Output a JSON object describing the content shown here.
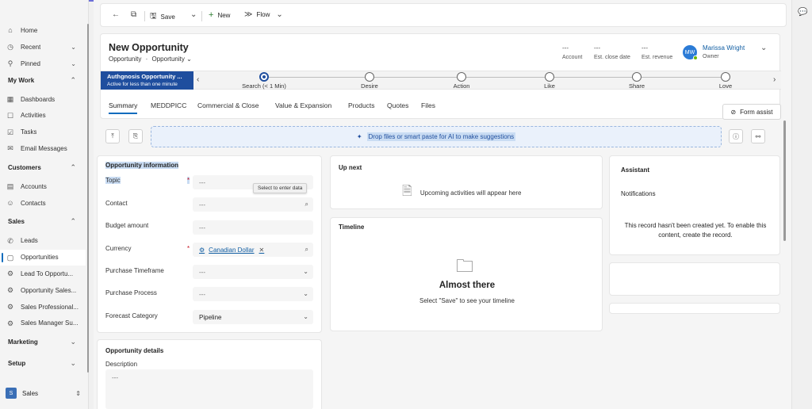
{
  "sidebar": {
    "items": [
      {
        "label": "Home",
        "icon": "home-icon",
        "glyph": "⌂",
        "chevron": ""
      },
      {
        "label": "Recent",
        "icon": "clock-icon",
        "glyph": "◷",
        "chevron": "⌄"
      },
      {
        "label": "Pinned",
        "icon": "pin-icon",
        "glyph": "⚲",
        "chevron": "⌄"
      }
    ],
    "groups": [
      {
        "label": "My Work",
        "chevron": "⌃",
        "items": [
          {
            "label": "Dashboards",
            "icon": "dashboard-icon",
            "glyph": "▦"
          },
          {
            "label": "Activities",
            "icon": "activities-icon",
            "glyph": "☐"
          },
          {
            "label": "Tasks",
            "icon": "tasks-icon",
            "glyph": "☑"
          },
          {
            "label": "Email Messages",
            "icon": "mail-icon",
            "glyph": "✉"
          }
        ]
      },
      {
        "label": "Customers",
        "chevron": "⌃",
        "items": [
          {
            "label": "Accounts",
            "icon": "building-icon",
            "glyph": "▤"
          },
          {
            "label": "Contacts",
            "icon": "person-icon",
            "glyph": "☺"
          }
        ]
      },
      {
        "label": "Sales",
        "chevron": "⌃",
        "items": [
          {
            "label": "Leads",
            "icon": "phone-icon",
            "glyph": "✆"
          },
          {
            "label": "Opportunities",
            "icon": "opportunity-icon",
            "glyph": "▢"
          },
          {
            "label": "Lead To Opportu...",
            "icon": "process-icon",
            "glyph": "⚙"
          },
          {
            "label": "Opportunity Sales...",
            "icon": "process-icon",
            "glyph": "⚙"
          },
          {
            "label": "Sales Professional...",
            "icon": "process-icon",
            "glyph": "⚙"
          },
          {
            "label": "Sales Manager Su...",
            "icon": "process-icon",
            "glyph": "⚙"
          }
        ]
      },
      {
        "label": "Marketing",
        "chevron": "⌄",
        "items": []
      },
      {
        "label": "Setup",
        "chevron": "⌄",
        "items": []
      }
    ],
    "area": {
      "badge": "S",
      "label": "Sales",
      "chevron": "⇕"
    }
  },
  "commandbar": {
    "back_icon": "←",
    "popout_icon": "⧉",
    "save_icon": "🖫",
    "save_label": "Save",
    "save_more": "⌄",
    "new_icon": "+",
    "new_label": "New",
    "flow_icon": "≫",
    "flow_label": "Flow",
    "flow_more": "⌄"
  },
  "header": {
    "title": "New Opportunity",
    "entity": "Opportunity",
    "separator": "·",
    "form": "Opportunity",
    "form_chevron": "⌄",
    "fields": [
      {
        "value": "---",
        "label": "Account"
      },
      {
        "value": "---",
        "label": "Est. close date"
      },
      {
        "value": "---",
        "label": "Est. revenue"
      }
    ],
    "owner": {
      "initials": "MW",
      "name": "Marissa Wright",
      "role": "Owner",
      "chevron": "⌄"
    }
  },
  "bpf": {
    "active_name": "Authgnosis Opportunity ...",
    "active_sub": "Active for less than one minute",
    "prev_icon": "‹",
    "next_icon": "›",
    "stages": [
      {
        "name": "Search  (< 1 Min)",
        "active": true
      },
      {
        "name": "Desire",
        "active": false
      },
      {
        "name": "Action",
        "active": false
      },
      {
        "name": "Like",
        "active": false
      },
      {
        "name": "Share",
        "active": false
      },
      {
        "name": "Love",
        "active": false
      }
    ]
  },
  "tabs": [
    "Summary",
    "MEDDPICC",
    "Commercial & Close",
    "Value & Expansion",
    "Products",
    "Quotes",
    "Files"
  ],
  "form_assist": {
    "label": "Form assist",
    "icon": "eye-off-icon"
  },
  "dropzone": {
    "text": "Drop files or smart paste for AI to make suggestions",
    "icon": "sparkle-icon"
  },
  "toolbar_icons": {
    "upload": "⤒",
    "paste": "⎘",
    "info": "ⓘ",
    "link": "⚯"
  },
  "info_section": {
    "title": "Opportunity information",
    "tooltip": "Select to enter data",
    "fields": [
      {
        "label": "Topic",
        "required": true,
        "value": "---",
        "type": "text"
      },
      {
        "label": "Contact",
        "required": false,
        "value": "---",
        "type": "lookup"
      },
      {
        "label": "Budget amount",
        "required": false,
        "value": "---",
        "type": "text"
      },
      {
        "label": "Currency",
        "required": true,
        "value": "Canadian Dollar",
        "type": "lookup-set"
      },
      {
        "label": "Purchase Timeframe",
        "required": false,
        "value": "---",
        "type": "select"
      },
      {
        "label": "Purchase Process",
        "required": false,
        "value": "---",
        "type": "select"
      },
      {
        "label": "Forecast Category",
        "required": false,
        "value": "Pipeline",
        "type": "select"
      }
    ],
    "required_mark": "*"
  },
  "details_section": {
    "title": "Opportunity details",
    "description_label": "Description",
    "description_value": "---"
  },
  "up_next": {
    "title": "Up next",
    "message": "Upcoming activities will appear here"
  },
  "timeline": {
    "title": "Timeline",
    "heading": "Almost there",
    "message": "Select \"Save\" to see your timeline"
  },
  "assistant": {
    "title": "Assistant",
    "notifications": "Notifications",
    "message": "This record hasn't been created yet. To enable this content, create the record."
  },
  "colors": {
    "accent": "#0f6cbd",
    "bpf_active": "#1f4e9e",
    "required": "#c50f1f",
    "dropzone_bg": "#eaf1fb"
  }
}
